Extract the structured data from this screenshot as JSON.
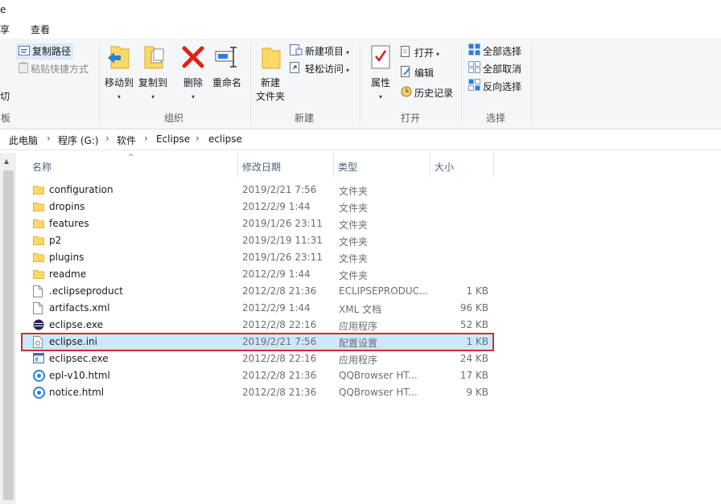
{
  "window": {
    "title_fragment": "e"
  },
  "tabs": {
    "share": "享",
    "view": "查看"
  },
  "ribbon": {
    "clipboard": {
      "copy_path": "复制路径",
      "paste_shortcut": "粘贴快捷方式",
      "cut_fragment": "切",
      "label_fragment": "板"
    },
    "organize": {
      "move_to": "移动到",
      "copy_to": "复制到",
      "delete": "删除",
      "rename": "重命名",
      "label": "组织"
    },
    "new": {
      "new_folder_line1": "新建",
      "new_folder_line2": "文件夹",
      "new_item": "新建项目",
      "easy_access": "轻松访问",
      "label": "新建"
    },
    "open": {
      "properties": "属性",
      "open": "打开",
      "edit": "编辑",
      "history": "历史记录",
      "label": "打开"
    },
    "select": {
      "select_all": "全部选择",
      "select_none": "全部取消",
      "invert": "反向选择",
      "label": "选择"
    }
  },
  "breadcrumb": [
    "此电脑",
    "程序 (G:)",
    "软件",
    "Eclipse",
    "eclipse"
  ],
  "columns": {
    "name": "名称",
    "date": "修改日期",
    "type": "类型",
    "size": "大小"
  },
  "files": [
    {
      "name": "configuration",
      "date": "2019/2/21 7:56",
      "type": "文件夹",
      "size": "",
      "icon": "folder-icon"
    },
    {
      "name": "dropins",
      "date": "2012/2/9 1:44",
      "type": "文件夹",
      "size": "",
      "icon": "folder-icon"
    },
    {
      "name": "features",
      "date": "2019/1/26 23:11",
      "type": "文件夹",
      "size": "",
      "icon": "folder-icon"
    },
    {
      "name": "p2",
      "date": "2019/2/19 11:31",
      "type": "文件夹",
      "size": "",
      "icon": "folder-icon"
    },
    {
      "name": "plugins",
      "date": "2019/1/26 23:11",
      "type": "文件夹",
      "size": "",
      "icon": "folder-icon"
    },
    {
      "name": "readme",
      "date": "2012/2/9 1:44",
      "type": "文件夹",
      "size": "",
      "icon": "folder-icon"
    },
    {
      "name": ".eclipseproduct",
      "date": "2012/2/8 21:36",
      "type": "ECLIPSEPRODUC...",
      "size": "1 KB",
      "icon": "file-icon"
    },
    {
      "name": "artifacts.xml",
      "date": "2012/2/9 1:44",
      "type": "XML 文档",
      "size": "96 KB",
      "icon": "file-icon"
    },
    {
      "name": "eclipse.exe",
      "date": "2012/2/8 22:16",
      "type": "应用程序",
      "size": "52 KB",
      "icon": "eclipse-icon"
    },
    {
      "name": "eclipse.ini",
      "date": "2019/2/21 7:56",
      "type": "配置设置",
      "size": "1 KB",
      "icon": "ini-file-icon"
    },
    {
      "name": "eclipsec.exe",
      "date": "2012/2/8 22:16",
      "type": "应用程序",
      "size": "24 KB",
      "icon": "exe-icon"
    },
    {
      "name": "epl-v10.html",
      "date": "2012/2/8 21:36",
      "type": "QQBrowser HT...",
      "size": "17 KB",
      "icon": "browser-icon"
    },
    {
      "name": "notice.html",
      "date": "2012/2/8 21:36",
      "type": "QQBrowser HT...",
      "size": "9 KB",
      "icon": "browser-icon"
    }
  ],
  "colors": {
    "selection": "#cce8ff",
    "highlight_border": "#d02c35",
    "folder": "#ffd865"
  }
}
